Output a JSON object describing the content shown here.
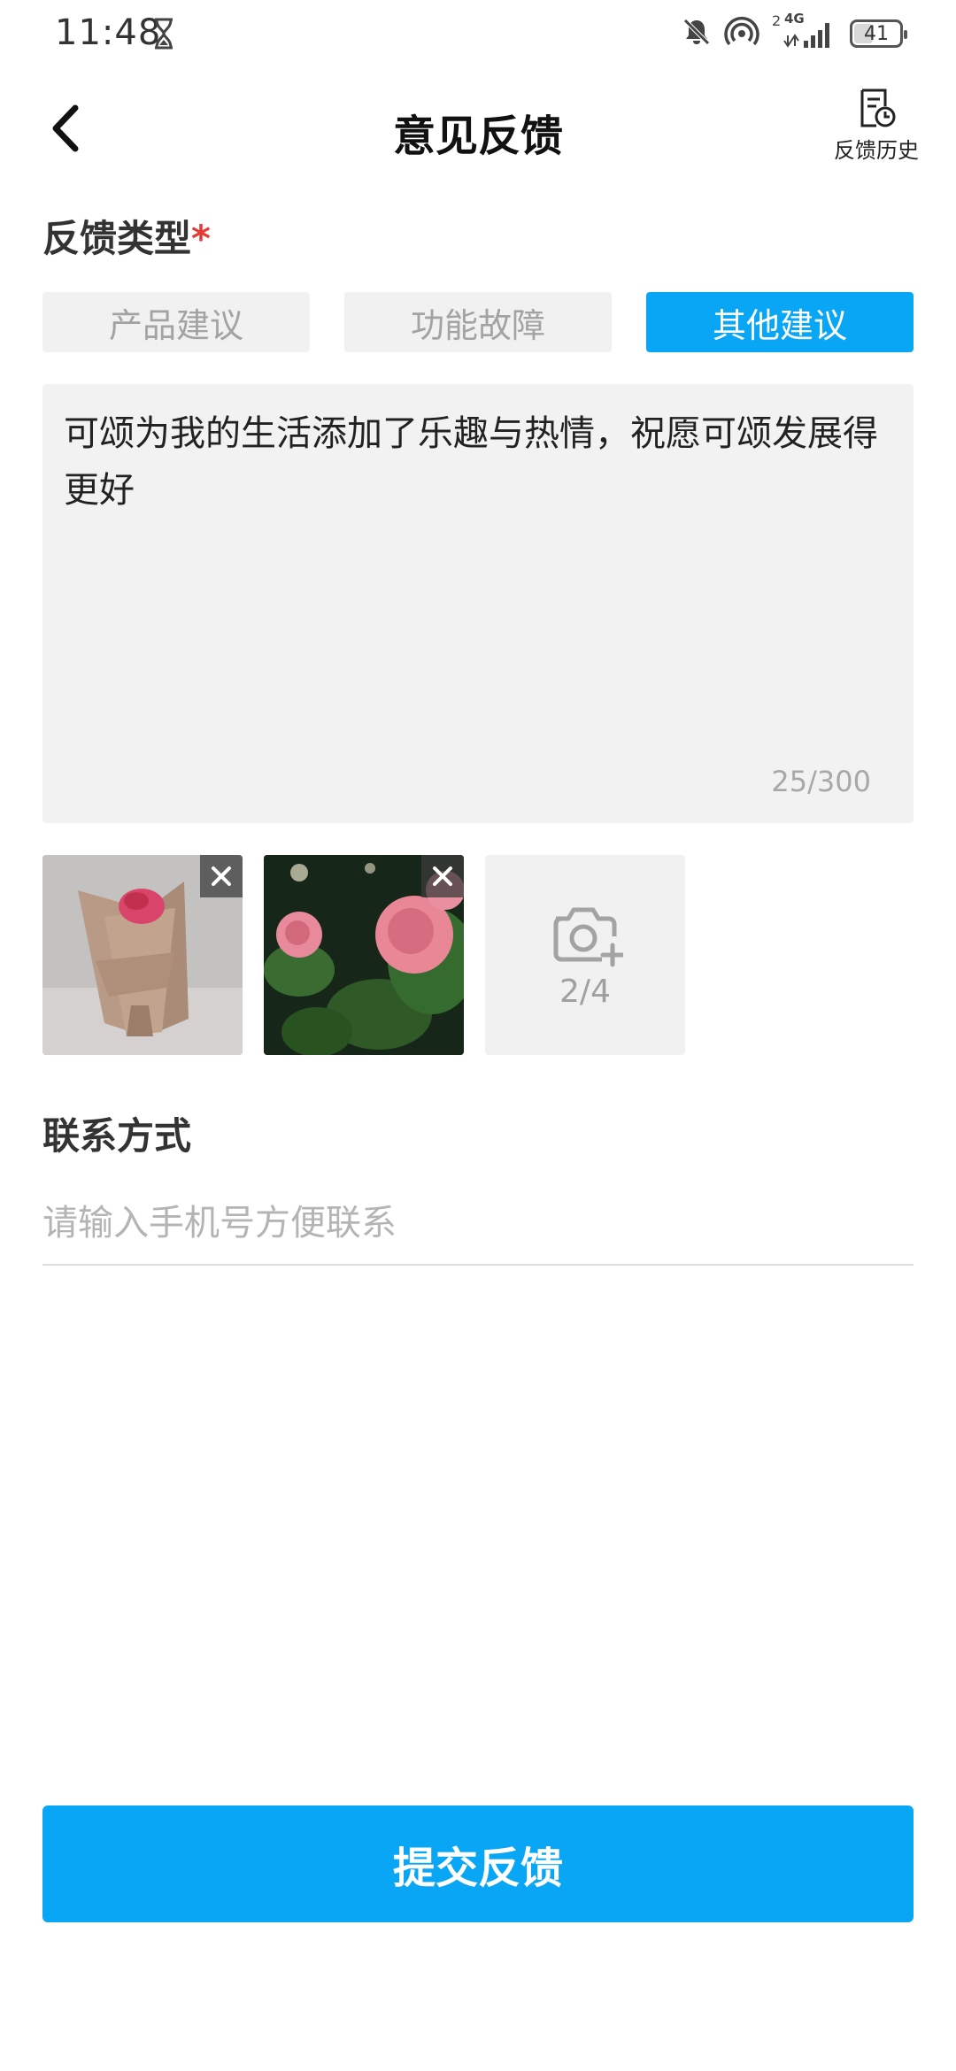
{
  "status_bar": {
    "time": "11:48",
    "network_sup": "2",
    "network_label": "4G",
    "battery": "41",
    "battery_level": 0.41,
    "icons": [
      "hourglass-icon",
      "bell-off-icon",
      "hotspot-icon",
      "signal-icon",
      "battery-icon"
    ]
  },
  "header": {
    "title": "意见反馈",
    "history_label": "反馈历史",
    "back_icon": "chevron-left-icon",
    "history_icon": "document-clock-icon"
  },
  "feedback_type": {
    "title": "反馈类型",
    "required_mark": "*",
    "options": [
      {
        "label": "产品建议",
        "selected": false
      },
      {
        "label": "功能故障",
        "selected": false
      },
      {
        "label": "其他建议",
        "selected": true
      }
    ]
  },
  "feedback": {
    "text": "可颂为我的生活添加了乐趣与热情，祝愿可颂发展得更好",
    "char_count": "25/300"
  },
  "images": {
    "count_label": "2/4",
    "items": [
      {
        "name": "rose-bouquet-photo"
      },
      {
        "name": "rose-garden-photo"
      }
    ],
    "add_icon": "camera-plus-icon",
    "remove_icon": "close-icon"
  },
  "contact": {
    "title": "联系方式",
    "placeholder": "请输入手机号方便联系",
    "value": ""
  },
  "submit": {
    "label": "提交反馈"
  },
  "colors": {
    "accent": "#0aa6f6",
    "required": "#e53935",
    "segment_bg": "#f1f1f1",
    "muted_text": "#a3a3a3"
  }
}
